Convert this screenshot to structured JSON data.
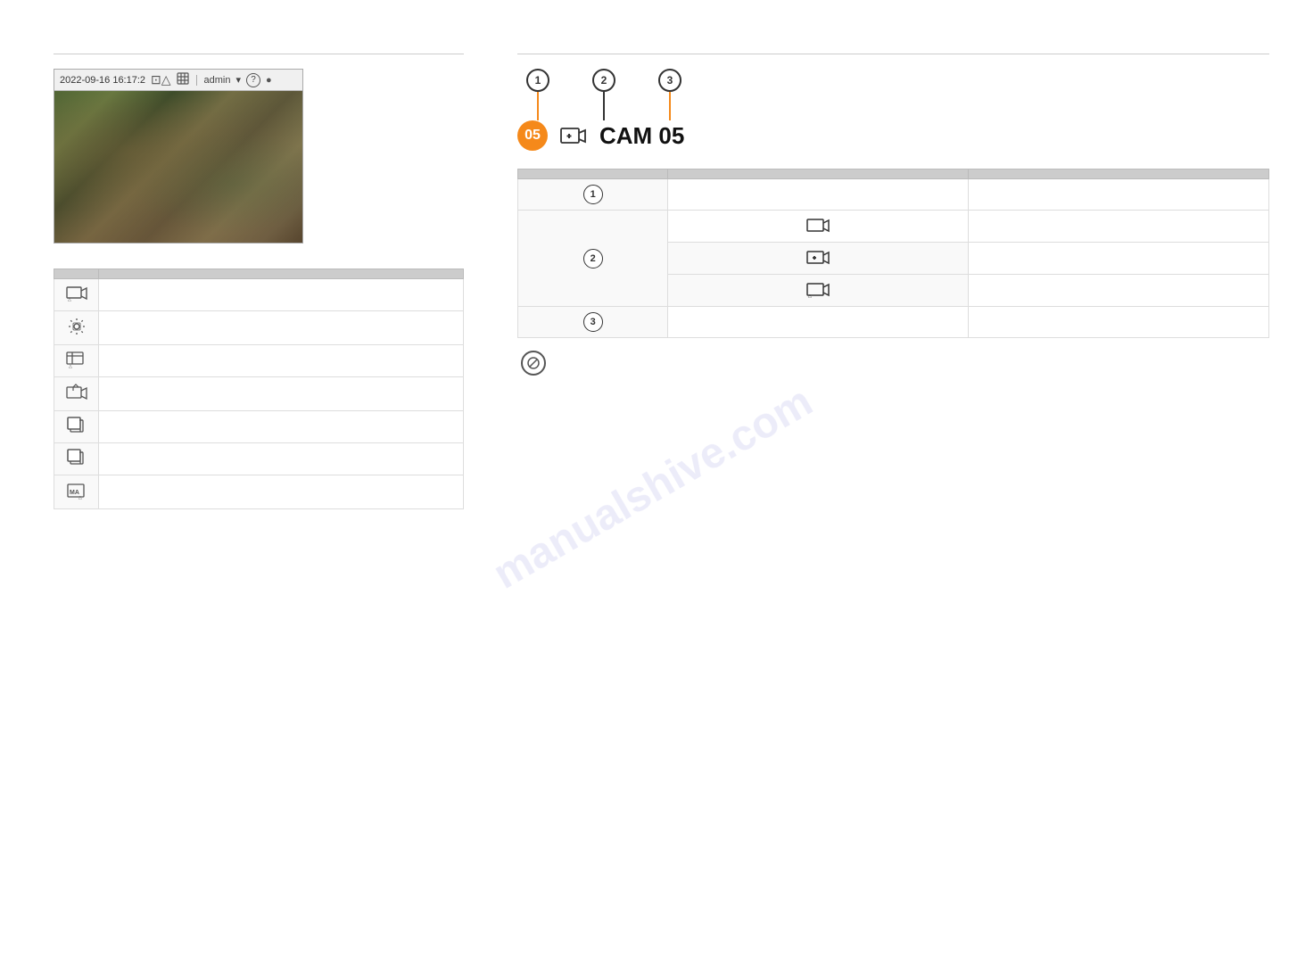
{
  "watermark": "manualshive.com",
  "left": {
    "section_line": true,
    "camera": {
      "timestamp": "2022-09-16 16:17:2",
      "icons": [
        "⊡△",
        "⚙",
        "admin",
        "▾",
        "?",
        "●"
      ]
    },
    "table": {
      "col1_header": "",
      "col2_header": "",
      "rows": [
        {
          "icon": "⊡△",
          "label": ""
        },
        {
          "icon": "⚙",
          "label": ""
        },
        {
          "icon": "☷△",
          "label": ""
        },
        {
          "icon": "⊡↑",
          "label": ""
        },
        {
          "icon": "□¹",
          "label": ""
        },
        {
          "icon": "□¹",
          "label": ""
        },
        {
          "icon": "ᴹ△",
          "label": ""
        }
      ]
    }
  },
  "right": {
    "section_line": true,
    "diagram": {
      "callouts": [
        {
          "number": "1",
          "orange": false
        },
        {
          "number": "2",
          "orange": false
        },
        {
          "number": "3",
          "orange": false
        }
      ],
      "badge": "05",
      "camera_icon": "⊡+",
      "cam_title": "CAM 05"
    },
    "table": {
      "col1_header": "",
      "col2_header": "",
      "col3_header": "",
      "rows": [
        {
          "num": "1",
          "sub_icon": "",
          "label": "",
          "rowspan": 1
        },
        {
          "num": "2",
          "sub_icons": [
            "⊡",
            "⊡+",
            "⊡△"
          ],
          "label": "",
          "rowspan": 3
        },
        {
          "num": "3",
          "sub_icon": "",
          "label": "",
          "rowspan": 1
        }
      ]
    },
    "note_icon": "Ø"
  }
}
